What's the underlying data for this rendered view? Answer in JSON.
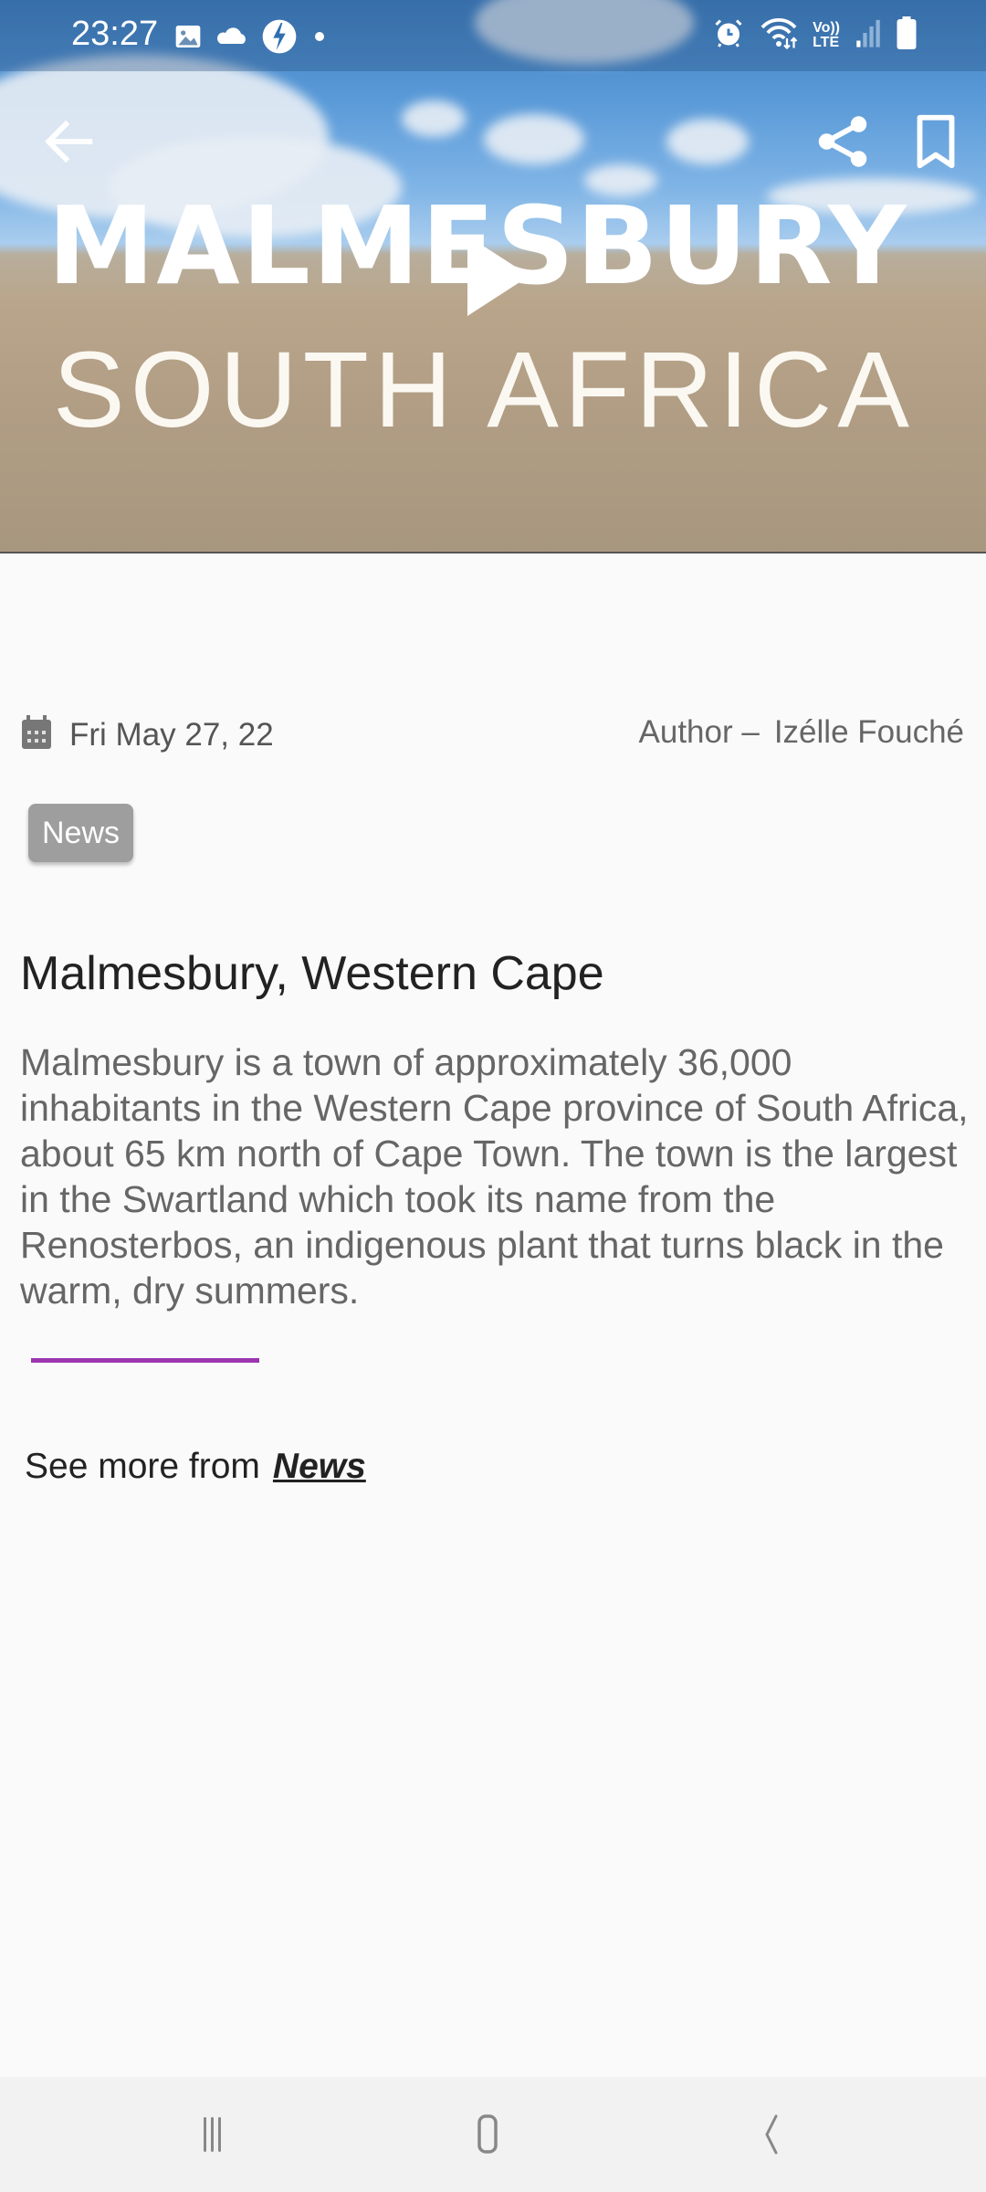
{
  "status_bar": {
    "time": "23:27",
    "left_icons": [
      "gallery-icon",
      "cloud-icon",
      "bolt-icon",
      "dot-icon"
    ],
    "right_icons": [
      "alarm-icon",
      "wifi-icon",
      "volte-icon",
      "signal-icon",
      "battery-icon"
    ],
    "volte_label_top": "Vo))",
    "volte_label_bottom": "LTE"
  },
  "hero": {
    "title_line_1": "MALMESBURY",
    "title_line_2": "SOUTH AFRICA",
    "play_icon": "play-icon"
  },
  "top_actions": {
    "back_icon": "arrow-back-icon",
    "share_icon": "share-icon",
    "bookmark_icon": "bookmark-icon"
  },
  "article": {
    "date": "Fri May 27, 22",
    "author_label": "Author –",
    "author_name": "Izélle Fouché",
    "tag": "News",
    "title": "Malmesbury, Western Cape",
    "body": "Malmesbury is a town of approximately 36,000 inhabitants in the Western Cape province of South Africa, about 65 km north of Cape Town. The town is the largest in the Swartland which took its name from the Renosterbos, an indigenous plant that turns black in the warm, dry summers.",
    "accent_color": "#9c35b0",
    "see_more_label": "See more from",
    "see_more_link": "News"
  },
  "nav_bar": {
    "recents_icon": "recents-icon",
    "home_icon": "home-icon",
    "back_icon": "nav-back-icon"
  }
}
